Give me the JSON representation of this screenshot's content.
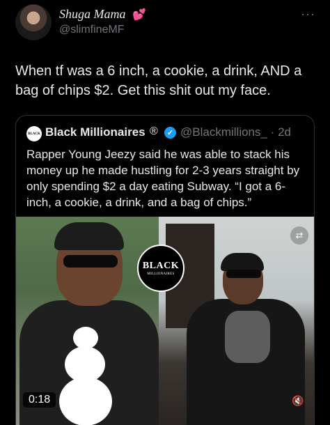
{
  "author": {
    "display_name": "Shuga Mama",
    "emoji_icon": "💕",
    "handle": "@slimfineMF",
    "more_icon": "···"
  },
  "tweet": {
    "text": "When tf was a 6 inch, a cookie, a drink, AND a bag of chips $2. Get this shit out my face."
  },
  "quote": {
    "logo_text": "BLACK",
    "name": "Black Millionaires",
    "reg_icon": "®",
    "verified_icon": "✓",
    "handle_time": "@Blackmillions_ · 2d",
    "text": "Rapper Young Jeezy said he was able to stack his money up he made hustling for 2-3 years straight by only spending $2 a day eating Subway. “I got a 6-inch, a cookie, a drink, and a bag of chips.”",
    "media": {
      "logo_word1": "BLACK",
      "logo_word2": "MILLIONAIRES",
      "toggle_icon": "⇄",
      "duration": "0:18",
      "mute_icon": "🔇"
    }
  },
  "colors": {
    "background": "#000000",
    "text": "#e7e9ea",
    "secondary": "#71767b",
    "verified": "#1d9bf0",
    "border": "#2f3336"
  }
}
